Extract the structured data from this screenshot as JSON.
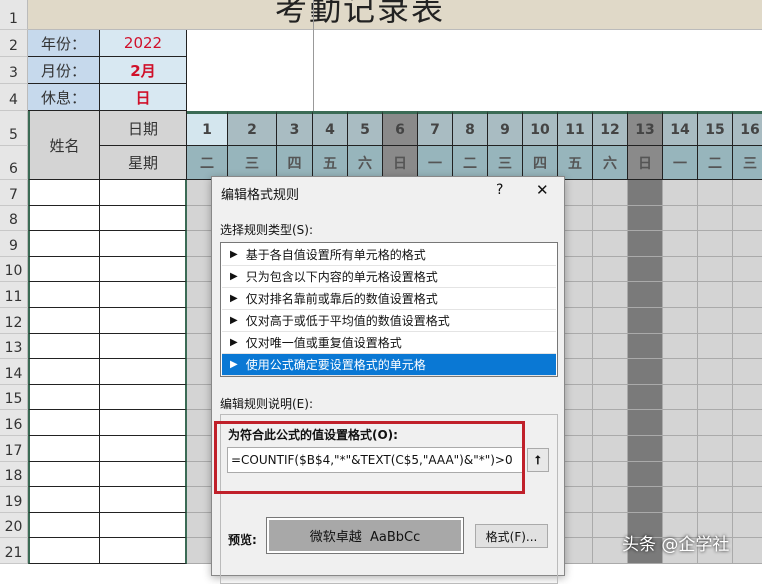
{
  "sheet": {
    "title": "考勤记录表",
    "row_numbers": [
      "1",
      "2",
      "3",
      "4",
      "5",
      "6",
      "7",
      "8",
      "9",
      "10",
      "11",
      "12",
      "13",
      "14",
      "15",
      "16",
      "17",
      "18",
      "19",
      "20",
      "21"
    ],
    "info": [
      {
        "label": "年份：",
        "value": "2022"
      },
      {
        "label": "月份：",
        "value": "2月"
      },
      {
        "label": "休息：",
        "value": "日"
      }
    ],
    "name_header": "姓名",
    "date_header": "日期",
    "weekday_header": "星期",
    "days": [
      "1",
      "2",
      "3",
      "4",
      "5",
      "6",
      "7",
      "8",
      "9",
      "10",
      "11",
      "12",
      "13",
      "14",
      "15",
      "16"
    ],
    "weekdays": [
      "二",
      "三",
      "四",
      "五",
      "六",
      "日",
      "一",
      "二",
      "三",
      "四",
      "五",
      "六",
      "日",
      "一",
      "二",
      "三"
    ],
    "colors": {
      "highlight_day": "#d4e6ee",
      "day": "#a9bcc2",
      "weekday": "#97b5bc",
      "sunday": "#8a8a8a",
      "body": "#d4d4d4",
      "body_sunday": "#7a7a7a",
      "value_red": "#d0102a"
    }
  },
  "dialog": {
    "title": "编辑格式规则",
    "help": "?",
    "close": "✕",
    "rule_type_label": "选择规则类型(S):",
    "rule_types": [
      "基于各自值设置所有单元格的格式",
      "只为包含以下内容的单元格设置格式",
      "仅对排名靠前或靠后的数值设置格式",
      "仅对高于或低于平均值的数值设置格式",
      "仅对唯一值或重复值设置格式",
      "使用公式确定要设置格式的单元格"
    ],
    "selected_index": 5,
    "description_label": "编辑规则说明(E):",
    "formula_label": "为符合此公式的值设置格式(O):",
    "formula": "=COUNTIF($B$4,\"*\"&TEXT(C$5,\"AAA\")&\"*\")>0",
    "preview_label": "预览:",
    "preview_text": "微软卓越  AaBbCc",
    "format_button": "格式(F)..."
  },
  "watermark": "头条 @企学社"
}
